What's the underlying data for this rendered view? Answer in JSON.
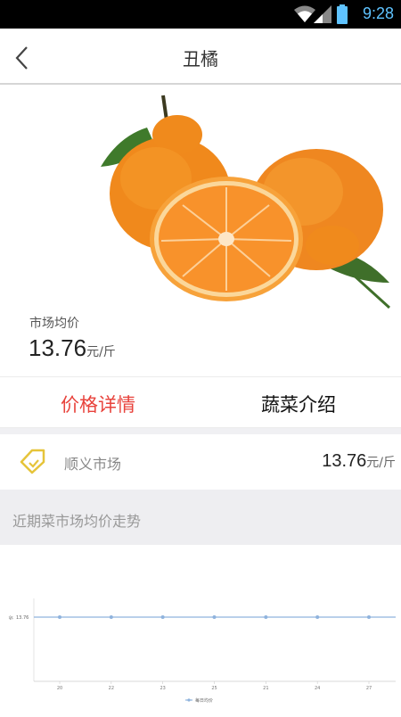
{
  "status_bar": {
    "time": "9:28"
  },
  "header": {
    "title": "丑橘"
  },
  "product": {
    "price_label": "市场均价",
    "price": "13.76",
    "unit": "元/斤"
  },
  "tabs": [
    {
      "label": "价格详情",
      "active": true
    },
    {
      "label": "蔬菜介绍",
      "active": false
    }
  ],
  "market": {
    "name": "顺义市场",
    "price": "13.76",
    "unit": "元/斤"
  },
  "trend": {
    "title": "近期菜市场均价走势"
  },
  "colors": {
    "accent": "#e8433c",
    "line": "#8fb3dd",
    "tag": "#e6c43a"
  },
  "chart_data": {
    "type": "line",
    "ylabel": "价",
    "categories": [
      "20",
      "22",
      "23",
      "25",
      "21",
      "24",
      "27"
    ],
    "series": [
      {
        "name": "每日均价",
        "values": [
          13.76,
          13.76,
          13.76,
          13.76,
          13.76,
          13.76,
          13.76
        ]
      }
    ],
    "y_tick": "13.76",
    "grid": false,
    "legend": "bottom"
  }
}
